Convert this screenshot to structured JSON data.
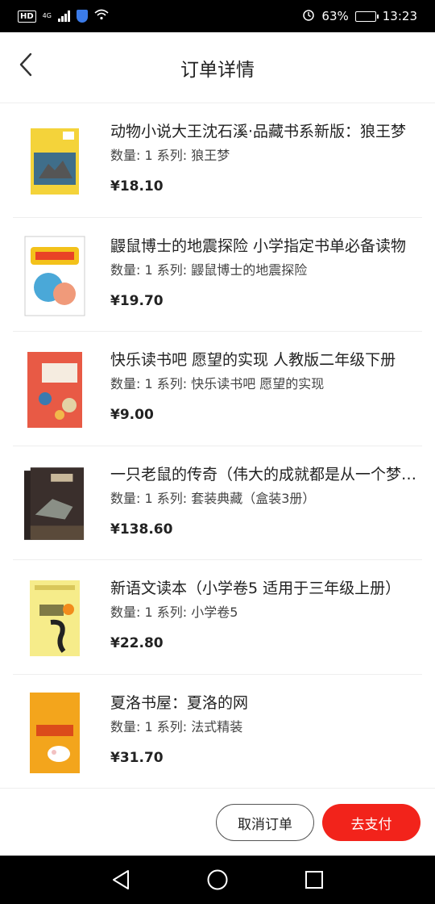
{
  "status_bar": {
    "hd": "HD",
    "network": "4G",
    "battery_percent": "63%",
    "battery_level": 0.63,
    "time": "13:23",
    "icons": [
      "signal-icon",
      "shield-icon",
      "wifi-icon",
      "alarm-icon",
      "battery-icon"
    ]
  },
  "header": {
    "title": "订单详情"
  },
  "items": [
    {
      "title": "动物小说大王沈石溪·品藏书系新版：狼王梦",
      "meta": "数量: 1 系列: 狼王梦",
      "price": "¥18.10",
      "cover_color": "#f4d33a"
    },
    {
      "title": "鼹鼠博士的地震探险 小学指定书单必备读物",
      "meta": "数量: 1 系列: 鼹鼠博士的地震探险",
      "price": "¥19.70",
      "cover_color": "#ffffff"
    },
    {
      "title": "快乐读书吧 愿望的实现 人教版二年级下册",
      "meta": "数量: 1 系列: 快乐读书吧 愿望的实现",
      "price": "¥9.00",
      "cover_color": "#e85a45"
    },
    {
      "title": "一只老鼠的传奇（伟大的成就都是从一个梦想开始）",
      "meta": "数量: 1 系列: 套装典藏（盒装3册）",
      "price": "¥138.60",
      "cover_color": "#3a2f2c"
    },
    {
      "title": "新语文读本（小学卷5 适用于三年级上册）",
      "meta": "数量: 1 系列: 小学卷5",
      "price": "¥22.80",
      "cover_color": "#f6ec8a"
    },
    {
      "title": "夏洛书屋：夏洛的网",
      "meta": "数量: 1 系列: 法式精装",
      "price": "¥31.70",
      "cover_color": "#f3a51c"
    }
  ],
  "actions": {
    "cancel_label": "取消订单",
    "pay_label": "去支付"
  },
  "colors": {
    "accent": "#f2231b",
    "divider": "#eeeeee"
  },
  "nav": {
    "icons": [
      "back-triangle-icon",
      "home-circle-icon",
      "recents-square-icon"
    ]
  }
}
